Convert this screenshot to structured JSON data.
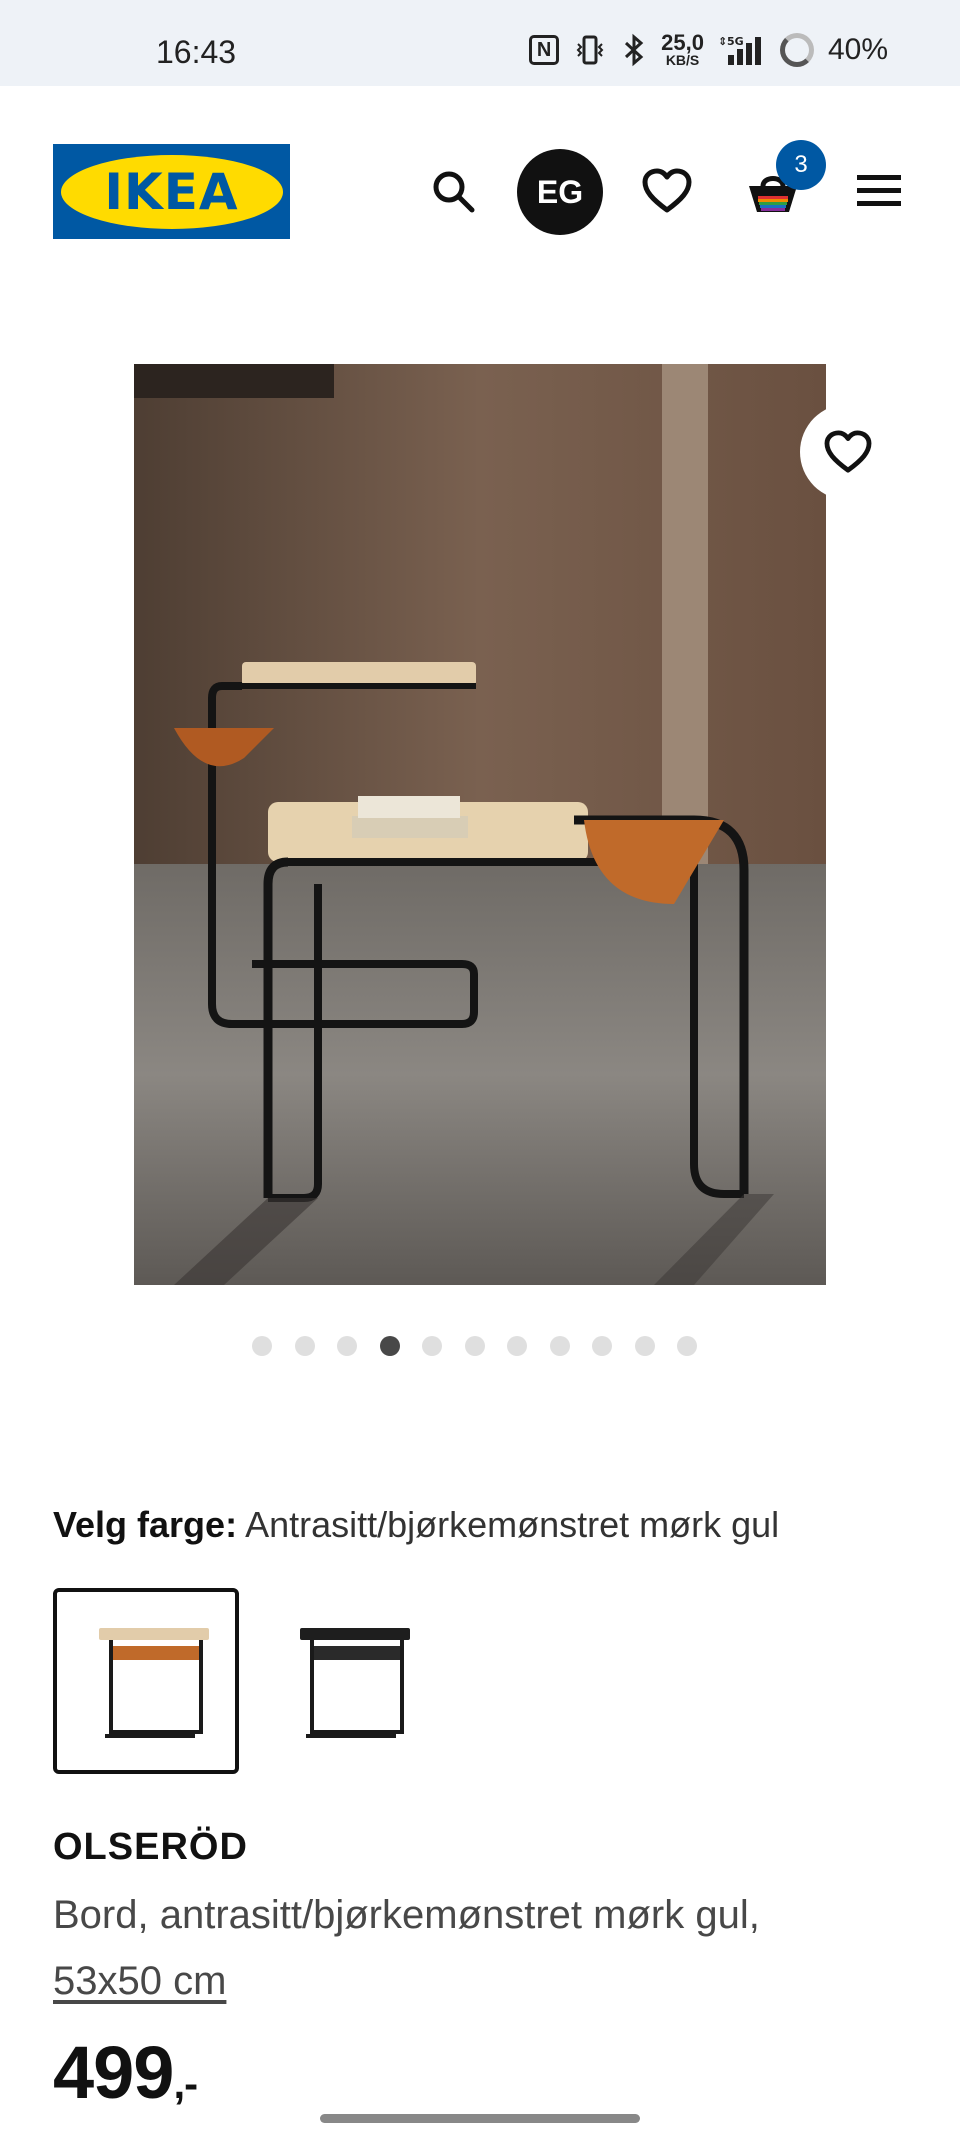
{
  "status_bar": {
    "time": "16:43",
    "network_speed_value": "25,0",
    "network_speed_unit": "KB/S",
    "network_type": "5G",
    "battery": "40%"
  },
  "header": {
    "logo_text": "IKEA",
    "avatar_initials": "EG",
    "cart_count": "3",
    "brand_blue": "#0058a3",
    "brand_yellow": "#ffdb00"
  },
  "gallery": {
    "image_count": 11,
    "active_index": 3
  },
  "color_selector": {
    "label": "Velg farge:",
    "value": "Antrasitt/bjørkemønstret mørk gul"
  },
  "product": {
    "name": "OLSERÖD",
    "description": "Bord, antrasitt/bjørkemønstret mørk gul,",
    "size": "53x50 cm",
    "price": "499",
    "price_suffix": ",-"
  }
}
